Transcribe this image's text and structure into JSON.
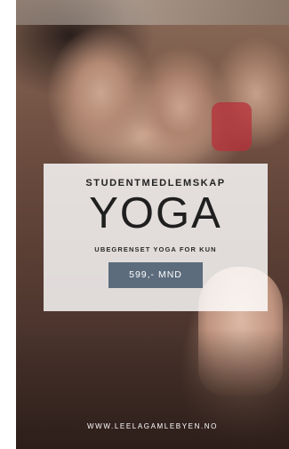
{
  "poster": {
    "eyebrow": "STUDENTMEDLEMSKAP",
    "headline": "YOGA",
    "subheading": "UBEGRENSET YOGA FOR KUN",
    "price_button": "599,- MND",
    "footer_url": "WWW.LEELAGAMLEBYEN.NO",
    "colors": {
      "price_bg": "#5d6c7d",
      "card_bg": "#ffffff"
    }
  }
}
